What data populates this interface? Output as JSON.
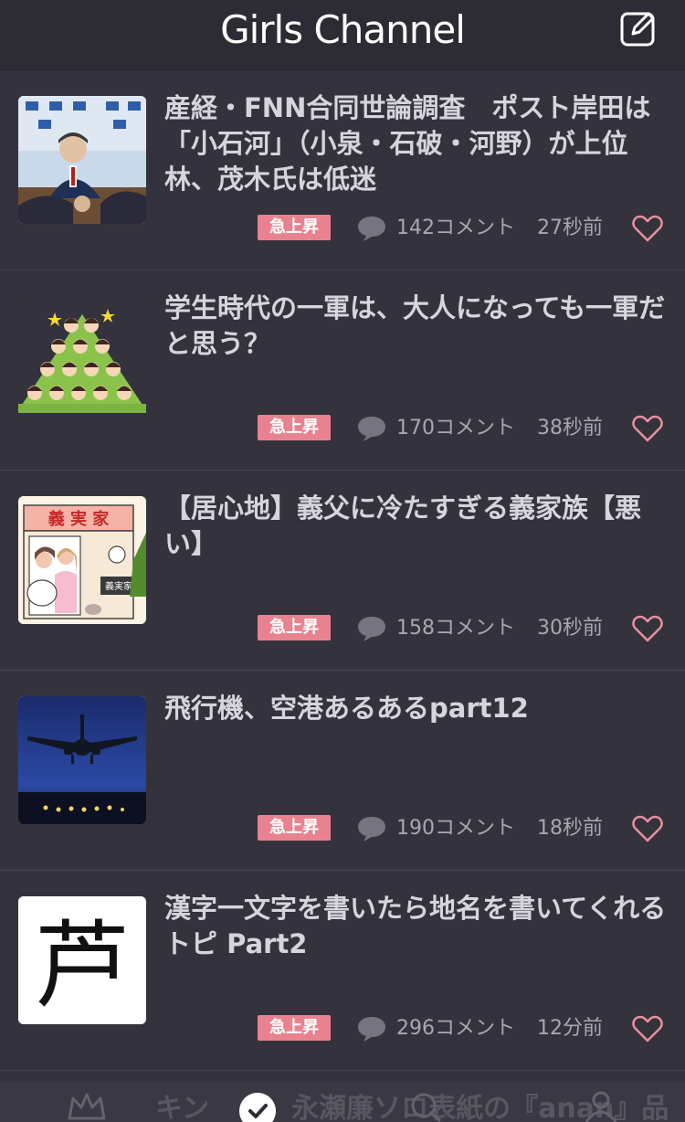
{
  "header": {
    "title": "Girls Channel",
    "compose_icon": "compose-icon"
  },
  "topics": [
    {
      "title": "産経・FNN合同世論調査　ポスト岸田は「小石河」（小泉・石破・河野）が上位林、茂木氏は低迷",
      "badge": "急上昇",
      "comments": "142コメント",
      "time": "27秒前"
    },
    {
      "title": "学生時代の一軍は、大人になっても一軍だと思う？",
      "badge": "急上昇",
      "comments": "170コメント",
      "time": "38秒前"
    },
    {
      "title": "【居心地】義父に冷たすぎる義家族【悪い】",
      "badge": "急上昇",
      "comments": "158コメント",
      "time": "30秒前",
      "thumb_sign": "義 実 家",
      "thumb_plate": "義実家"
    },
    {
      "title": "飛行機、空港あるあるpart12",
      "badge": "急上昇",
      "comments": "190コメント",
      "time": "18秒前"
    },
    {
      "title": "漢字一文字を書いたら地名を書いてくれるトピ Part2",
      "badge": "急上昇",
      "comments": "296コメント",
      "time": "12分前",
      "thumb_kanji": "芦"
    }
  ],
  "tabbar": {
    "ghost_text": "キン　　　永瀬廉ソロ表紙の『anan』品"
  },
  "colors": {
    "badge": "#e9828f",
    "background": "#34333d",
    "header": "#2d2c35",
    "heart": "#e98fa0"
  }
}
